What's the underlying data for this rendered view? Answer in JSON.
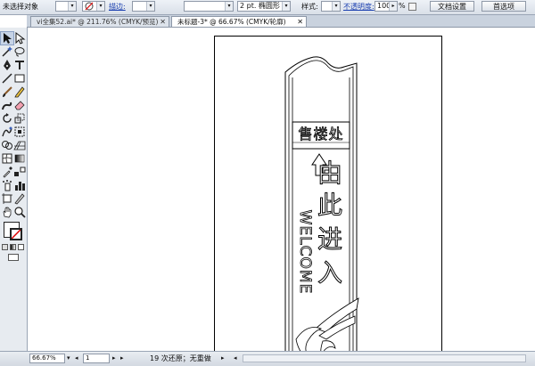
{
  "control_bar": {
    "selection_status": "未选择对象",
    "stroke_label": "描边:",
    "stroke_profile": "2 pt. 椭圆形",
    "style_label": "样式:",
    "opacity_label": "不透明度:",
    "opacity_value": "100",
    "opacity_unit": "%",
    "doc_setup_button": "文档设置",
    "preferences_button": "首选项"
  },
  "tabs": [
    {
      "label": "vi全集52.ai* @ 211.76% (CMYK/预览)",
      "close": "✕",
      "active": false
    },
    {
      "label": "未标题-3* @ 66.67% (CMYK/轮廓)",
      "close": "✕",
      "active": true
    }
  ],
  "artwork": {
    "sign_title": "售楼处",
    "vertical_text": [
      "由",
      "此",
      "进",
      "入"
    ],
    "welcome_text": "WELCOME"
  },
  "status_bar": {
    "zoom": "66.67%",
    "page": "1",
    "history": "19 次还原；无重做"
  },
  "colors": {
    "chrome_bg": "#dde3eb",
    "link_blue": "#1a3fb0",
    "artwork_stroke": "#000000"
  },
  "icons": [
    "selection-tool-icon",
    "direct-selection-tool-icon",
    "magic-wand-icon",
    "lasso-icon",
    "pen-tool-icon",
    "type-tool-icon",
    "line-tool-icon",
    "rectangle-tool-icon",
    "paintbrush-icon",
    "pencil-icon",
    "blob-brush-icon",
    "eraser-icon",
    "rotate-icon",
    "scale-icon",
    "warp-icon",
    "free-transform-icon",
    "shape-builder-icon",
    "perspective-grid-icon",
    "mesh-icon",
    "gradient-icon",
    "eyedropper-icon",
    "blend-icon",
    "symbol-sprayer-icon",
    "column-graph-icon",
    "artboard-tool-icon",
    "slice-tool-icon",
    "hand-tool-icon",
    "zoom-tool-icon",
    "fill-swatch-icon",
    "stroke-swatch-icon",
    "color-mode-icon",
    "screen-mode-icon"
  ]
}
